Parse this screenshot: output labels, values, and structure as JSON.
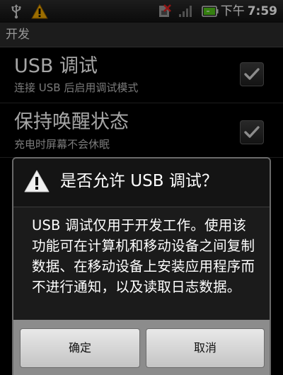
{
  "status_bar": {
    "icons": [
      "usb-icon",
      "warning-icon",
      "no-sim-icon",
      "signal-icon",
      "battery-icon"
    ],
    "ampm": "下午",
    "time": "7:59"
  },
  "title_bar": {
    "title": "开发"
  },
  "settings": [
    {
      "title": "USB 调试",
      "summary": "连接 USB 后启用调试模式",
      "checked": true
    },
    {
      "title": "保持唤醒状态",
      "summary": "充电时屏幕不会休眠",
      "checked": true
    }
  ],
  "dialog": {
    "icon": "warning-icon",
    "title": "是否允许 USB 调试？",
    "message": "USB 调试仅用于开发工作。使用该功能可在计算机和移动设备之间复制数据、在移动设备上安装应用程序而不进行通知，以及读取日志数据。",
    "ok_label": "确定",
    "cancel_label": "取消"
  },
  "colors": {
    "warning": "#f2a900",
    "background": "#000000",
    "dialog_background": "#1b1b1b",
    "button_gradient_top": "#e8e8e8"
  }
}
